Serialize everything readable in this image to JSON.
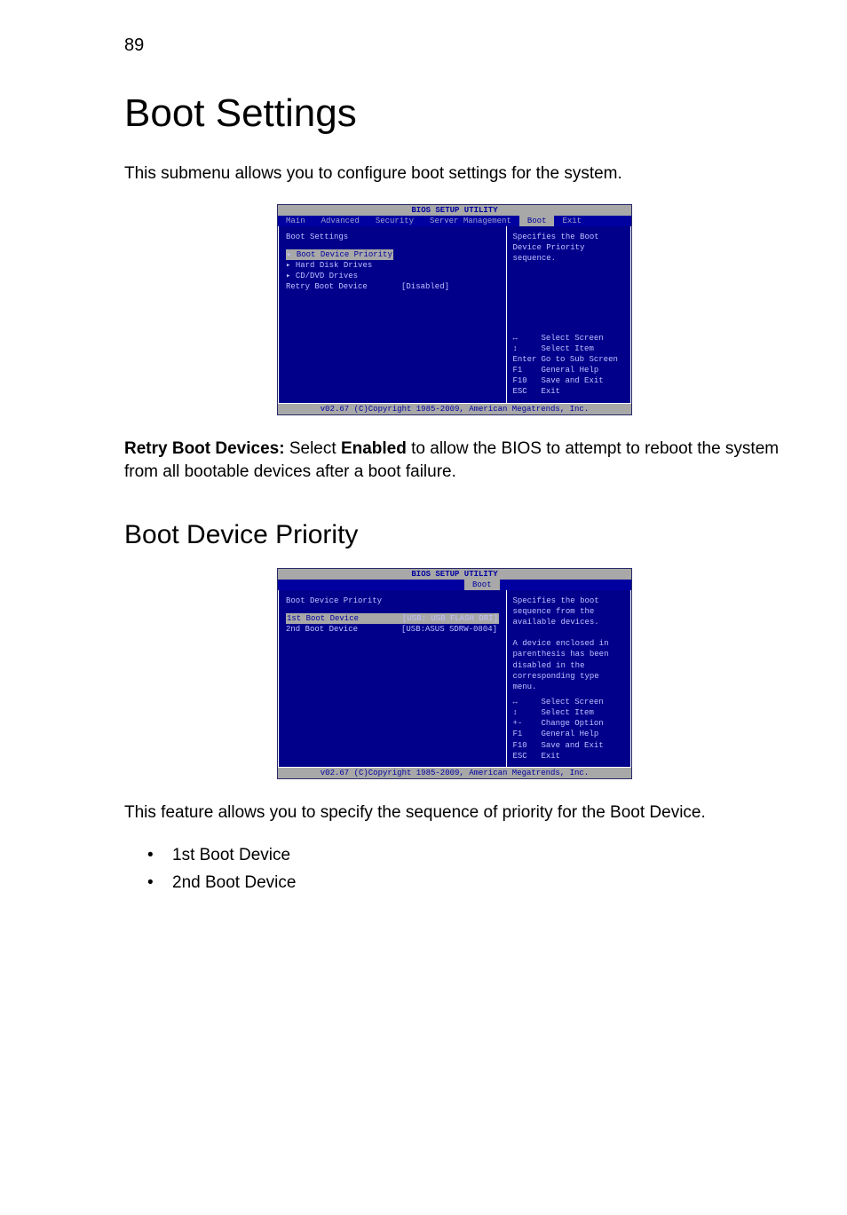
{
  "page_number": "89",
  "h1": "Boot Settings",
  "intro": "This submenu allows you to configure boot settings for the system.",
  "bios1": {
    "title": "BIOS SETUP UTILITY",
    "tabs": [
      "Main",
      "Advanced",
      "Security",
      "Server Management",
      "Boot",
      "Exit"
    ],
    "active_tab": "Boot",
    "left": {
      "heading": "Boot Settings",
      "items": [
        {
          "label": "Boot Device Priority",
          "arrow": true,
          "highlight": true
        },
        {
          "label": "Hard Disk Drives",
          "arrow": true
        },
        {
          "label": "CD/DVD Drives",
          "arrow": true
        },
        {
          "label": "Retry Boot Device",
          "value": "[Disabled]"
        }
      ]
    },
    "right": {
      "help": "Specifies the Boot Device Priority sequence.",
      "nav": [
        {
          "key": "↔",
          "text": "Select Screen"
        },
        {
          "key": "↕",
          "text": "Select Item"
        },
        {
          "key": "Enter",
          "text": "Go to Sub Screen"
        },
        {
          "key": "F1",
          "text": "General Help"
        },
        {
          "key": "F10",
          "text": "Save and Exit"
        },
        {
          "key": "ESC",
          "text": "Exit"
        }
      ]
    },
    "footer": "v02.67 (C)Copyright 1985-2009, American Megatrends, Inc."
  },
  "retry_para_prefix": "Retry Boot Devices:",
  "retry_para_mid1": " Select ",
  "retry_para_bold2": "Enabled",
  "retry_para_rest": " to allow the BIOS to attempt to reboot the system from all bootable devices after a boot failure.",
  "h2": "Boot Device Priority",
  "bios2": {
    "title": "BIOS SETUP UTILITY",
    "tabs_visible": [
      "Boot"
    ],
    "left": {
      "heading": "Boot Device Priority",
      "items": [
        {
          "label": "1st Boot Device",
          "value": "[USB: USB FLASH DRI]",
          "highlight": true
        },
        {
          "label": "2nd Boot Device",
          "value": "[USB:ASUS SDRW-0804]"
        }
      ]
    },
    "right": {
      "help": "Specifies the boot sequence from the available devices.\n\nA device enclosed in parenthesis has been disabled in the corresponding type menu.",
      "nav": [
        {
          "key": "↔",
          "text": "Select Screen"
        },
        {
          "key": "↕",
          "text": "Select Item"
        },
        {
          "key": "+-",
          "text": "Change Option"
        },
        {
          "key": "F1",
          "text": "General Help"
        },
        {
          "key": "F10",
          "text": "Save and Exit"
        },
        {
          "key": "ESC",
          "text": "Exit"
        }
      ]
    },
    "footer": "v02.67 (C)Copyright 1985-2009, American Megatrends, Inc."
  },
  "priority_para": "This feature allows you to specify the sequence of priority for the Boot Device.",
  "bullets": [
    "1st Boot Device",
    "2nd Boot Device"
  ]
}
